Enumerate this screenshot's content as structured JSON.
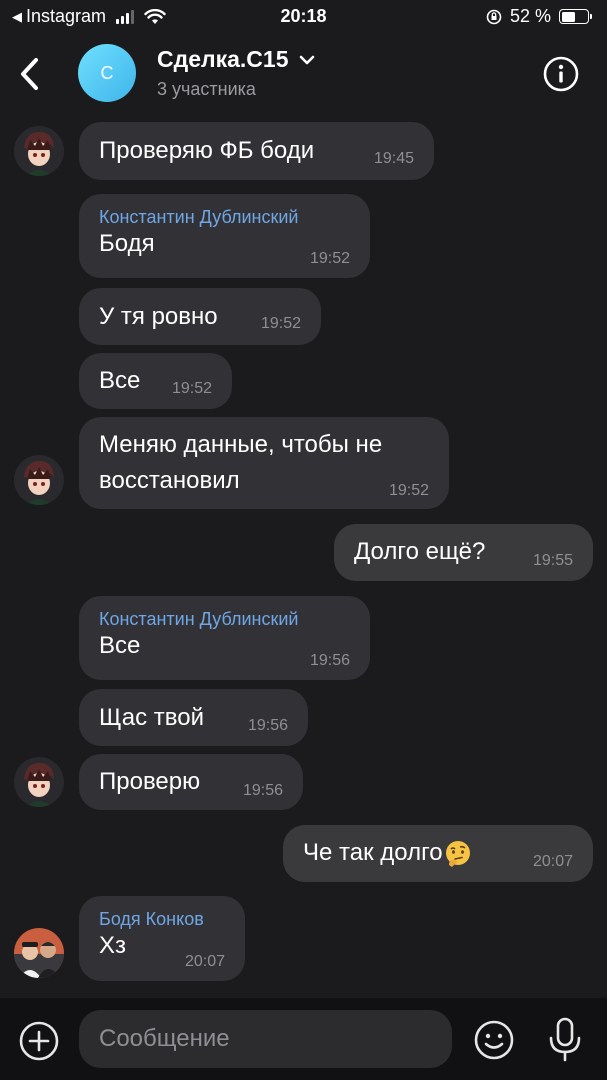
{
  "status_bar": {
    "back_app": "Instagram",
    "time": "20:18",
    "battery": "52 %",
    "battery_level": 0.52
  },
  "header": {
    "avatar_letter": "С",
    "title": "Сделка.С15",
    "subtitle": "3 участника"
  },
  "messages": [
    {
      "text": "Проверяю ФБ боди",
      "time": "19:45"
    },
    {
      "sender": "Константин Дублинский",
      "text": "Бодя",
      "time": "19:52"
    },
    {
      "text": "У тя ровно",
      "time": "19:52"
    },
    {
      "text": "Все",
      "time": "19:52"
    },
    {
      "text": "Меняю данные, чтобы не",
      "text2": "восстановил",
      "time": "19:52"
    },
    {
      "text": "Долго ещё?",
      "time": "19:55",
      "outgoing": true
    },
    {
      "sender": "Константин Дублинский",
      "text": "Все",
      "time": "19:56"
    },
    {
      "text": "Щас твой",
      "time": "19:56"
    },
    {
      "text": "Проверю",
      "time": "19:56"
    },
    {
      "text": "Че так долго",
      "emoji": "thinking-face",
      "time": "20:07",
      "outgoing": true
    },
    {
      "sender": "Бодя Конков",
      "text": "Хз",
      "time": "20:07"
    }
  ],
  "composer": {
    "placeholder": "Сообщение"
  },
  "colors": {
    "background": "#1b1b1d",
    "bubble": "#323236",
    "sender_name": "#6fa6e6",
    "avatar": "#4cc6f2"
  }
}
